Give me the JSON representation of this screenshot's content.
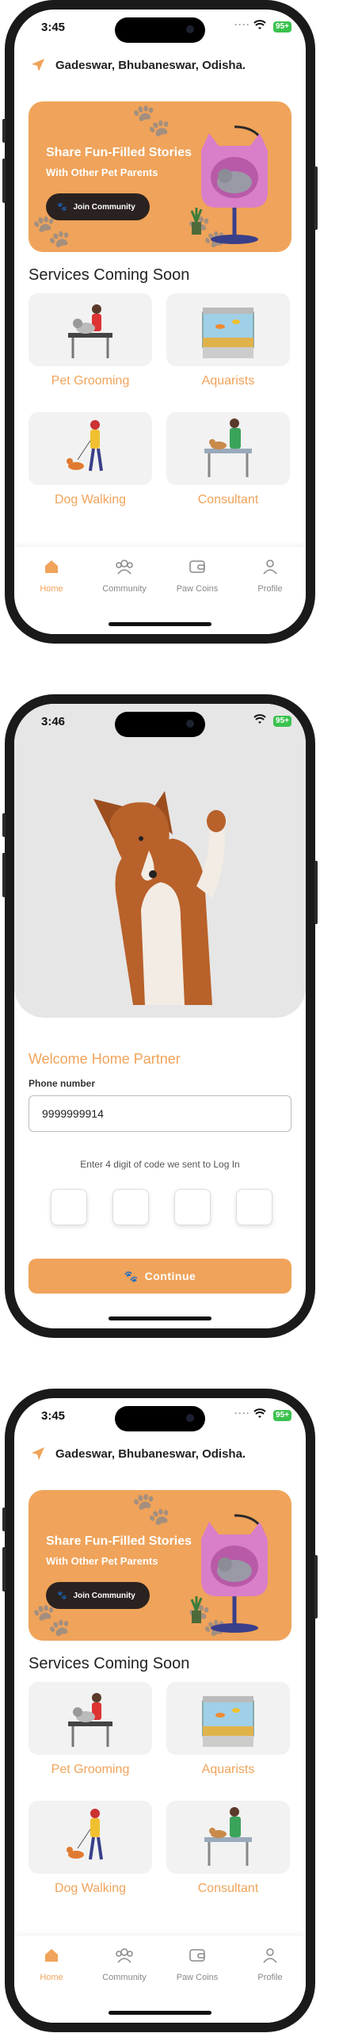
{
  "screens": [
    {
      "status": {
        "time": "3:45",
        "battery": "95+"
      },
      "location": "Gadeswar, Bhubaneswar, Odisha.",
      "banner": {
        "title": "Share Fun-Filled Stories",
        "subtitle": "With Other Pet Parents",
        "join_label": "Join Community"
      },
      "section_title": "Services Coming Soon",
      "services": [
        {
          "label": "Pet Grooming",
          "icon": "grooming-illustration"
        },
        {
          "label": "Aquarists",
          "icon": "aquarium-illustration"
        },
        {
          "label": "Dog Walking",
          "icon": "dog-walking-illustration"
        },
        {
          "label": "Consultant",
          "icon": "vet-consultant-illustration"
        }
      ],
      "tabs": [
        {
          "label": "Home",
          "icon": "home-icon",
          "active": true
        },
        {
          "label": "Community",
          "icon": "community-icon",
          "active": false
        },
        {
          "label": "Paw Coins",
          "icon": "wallet-icon",
          "active": false
        },
        {
          "label": "Profile",
          "icon": "profile-icon",
          "active": false
        }
      ]
    },
    {
      "status": {
        "time": "3:46",
        "battery": "95+"
      },
      "welcome": "Welcome Home Partner",
      "phone_label": "Phone number",
      "phone_value": "9999999914",
      "code_hint": "Enter 4 digit of code we sent to Log In",
      "otp_count": 4,
      "continue_label": "Continue"
    },
    {
      "status": {
        "time": "3:45",
        "battery": "95+"
      },
      "location": "Gadeswar, Bhubaneswar, Odisha.",
      "banner": {
        "title": "Share Fun-Filled Stories",
        "subtitle": "With Other Pet Parents",
        "join_label": "Join Community"
      },
      "section_title": "Services Coming Soon",
      "services": [
        {
          "label": "Pet Grooming",
          "icon": "grooming-illustration"
        },
        {
          "label": "Aquarists",
          "icon": "aquarium-illustration"
        },
        {
          "label": "Dog Walking",
          "icon": "dog-walking-illustration"
        },
        {
          "label": "Consultant",
          "icon": "vet-consultant-illustration"
        }
      ],
      "tabs": [
        {
          "label": "Home",
          "icon": "home-icon",
          "active": true
        },
        {
          "label": "Community",
          "icon": "community-icon",
          "active": false
        },
        {
          "label": "Paw Coins",
          "icon": "wallet-icon",
          "active": false
        },
        {
          "label": "Profile",
          "icon": "profile-icon",
          "active": false
        }
      ]
    }
  ],
  "colors": {
    "accent": "#f0a35a",
    "dark": "#2a2220",
    "battery": "#3bc24e"
  }
}
